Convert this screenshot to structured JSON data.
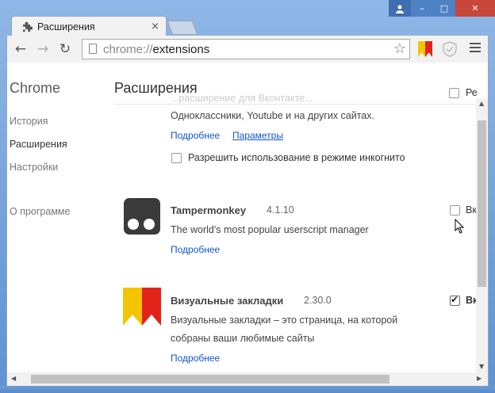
{
  "tab": {
    "title": "Расширения",
    "close": "×"
  },
  "toolbar": {
    "url_scheme": "chrome://",
    "url_host": "extensions",
    "back": "←",
    "forward": "→",
    "reload": "↻",
    "star": "☆"
  },
  "window": {
    "minimize": "‒",
    "maximize": "□",
    "close": "✕",
    "user": "👤"
  },
  "sidebar": {
    "title": "Chrome",
    "items": [
      {
        "label": "История"
      },
      {
        "label": "Расширения"
      },
      {
        "label": "Настройки"
      },
      {
        "label": "О программе"
      }
    ]
  },
  "main": {
    "title": "Расширения",
    "dev_mode_label": "Ре",
    "ghost_text": "...расширение для Вконтакте...",
    "ext0": {
      "desc": "Одноклассники, Youtube и на других сайтах.",
      "details_link": "Подробнее",
      "options_link": "Параметры",
      "incognito_label": "Разрешить использование в режиме инкогнито"
    },
    "ext1": {
      "name": "Tampermonkey",
      "version": "4.1.10",
      "desc": "The world's most popular userscript manager",
      "details_link": "Подробнее",
      "enable_label": "Вк",
      "enabled": false
    },
    "ext2": {
      "name": "Визуальные закладки",
      "version": "2.30.0",
      "desc_line1": "Визуальные закладки – это страница, на которой",
      "desc_line2": "собраны ваши любимые сайты",
      "details_link": "Подробнее",
      "enable_label": "Вк",
      "enabled": true
    }
  },
  "colors": {
    "link": "#1155cc",
    "title_bar": "#5e92d1",
    "close_button": "#c7473b"
  }
}
